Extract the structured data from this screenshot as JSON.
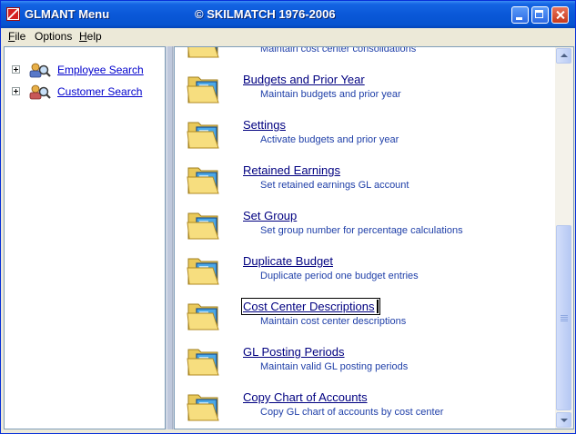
{
  "window": {
    "title": "GLMANT Menu",
    "center_title": "© SKILMATCH 1976-2006"
  },
  "menubar": {
    "items": [
      {
        "accel": "F",
        "rest": "ile"
      },
      {
        "accel": "",
        "rest": "Options"
      },
      {
        "accel": "H",
        "rest": "elp"
      }
    ]
  },
  "tree": {
    "items": [
      {
        "label": "Employee Search",
        "icon": "employee-search-icon"
      },
      {
        "label": "Customer Search",
        "icon": "customer-search-icon"
      }
    ]
  },
  "list": {
    "partial_item": {
      "desc": "Maintain cost center consolidations"
    },
    "items": [
      {
        "title": "Budgets and Prior Year",
        "desc": "Maintain budgets and prior year"
      },
      {
        "title": "Settings",
        "desc": "Activate budgets and prior year"
      },
      {
        "title": "Retained Earnings ",
        "desc": "Set retained earnings GL account"
      },
      {
        "title": "Set Group",
        "desc": "Set group number for percentage calculations"
      },
      {
        "title": "Duplicate Budget",
        "desc": "Duplicate period one budget entries"
      },
      {
        "title": "Cost Center Descriptions",
        "desc": "Maintain cost center descriptions"
      },
      {
        "title": "GL Posting Periods",
        "desc": "Maintain valid GL posting periods"
      },
      {
        "title": "Copy Chart of Accounts",
        "desc": "Copy GL chart of accounts by cost center"
      }
    ]
  },
  "colors": {
    "titlebar": "#0A58D8",
    "link": "#000080",
    "description": "#1F3FA8"
  }
}
